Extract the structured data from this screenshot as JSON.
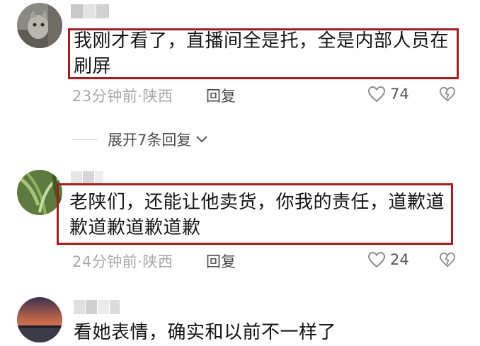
{
  "comments": [
    {
      "text_line1": "我刚才看了，直播间全是托，全是内部人员在",
      "text_line2": "刷屏",
      "time": "23分钟前",
      "location": "陕西",
      "reply_label": "回复",
      "likes": "74"
    },
    {
      "text_line1": "老陕们，还能让他卖货，你我的责任，道歉道",
      "text_line2": "歉道歉道歉道歉",
      "time": "24分钟前",
      "location": "陕西",
      "reply_label": "回复",
      "likes": "24"
    },
    {
      "text_line1": "看她表情，确实和以前不一样了"
    }
  ],
  "expand_replies": "展开7条回复",
  "separator": "·",
  "icons": {
    "like": "heart-outline-icon",
    "dislike": "broken-heart-icon",
    "expand": "chevron-down-icon"
  },
  "colors": {
    "highlight_box": "#a51d1f",
    "meta_text": "#a8a8a8"
  }
}
